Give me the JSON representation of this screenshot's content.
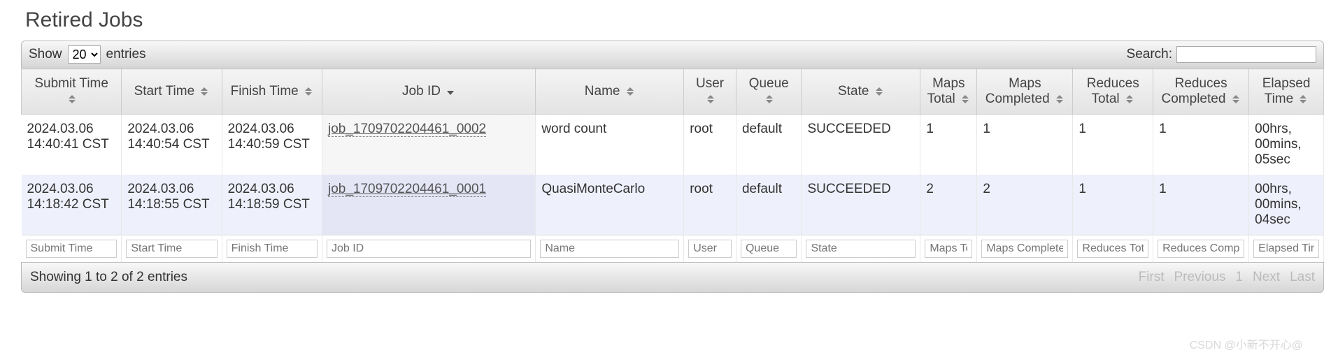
{
  "title": "Retired Jobs",
  "toolbar": {
    "show_label": "Show",
    "entries_label": "entries",
    "search_label": "Search:",
    "page_size_value": "20"
  },
  "columns": {
    "submit_time": "Submit Time",
    "start_time": "Start Time",
    "finish_time": "Finish Time",
    "job_id": "Job ID",
    "name": "Name",
    "user": "User",
    "queue": "Queue",
    "state": "State",
    "maps_total": "Maps Total",
    "maps_completed": "Maps Completed",
    "reduces_total": "Reduces Total",
    "reduces_completed": "Reduces Completed",
    "elapsed_time": "Elapsed Time"
  },
  "filters": {
    "submit_time": "Submit Time",
    "start_time": "Start Time",
    "finish_time": "Finish Time",
    "job_id": "Job ID",
    "name": "Name",
    "user": "User",
    "queue": "Queue",
    "state": "State",
    "maps_total": "Maps Total",
    "maps_completed": "Maps Completed",
    "reduces_total": "Reduces Total",
    "reduces_completed": "Reduces Completed",
    "elapsed_time": "Elapsed Time"
  },
  "rows": [
    {
      "submit_time": "2024.03.06 14:40:41 CST",
      "start_time": "2024.03.06 14:40:54 CST",
      "finish_time": "2024.03.06 14:40:59 CST",
      "job_id": "job_1709702204461_0002",
      "name": "word count",
      "user": "root",
      "queue": "default",
      "state": "SUCCEEDED",
      "maps_total": "1",
      "maps_completed": "1",
      "reduces_total": "1",
      "reduces_completed": "1",
      "elapsed_time": "00hrs, 00mins, 05sec"
    },
    {
      "submit_time": "2024.03.06 14:18:42 CST",
      "start_time": "2024.03.06 14:18:55 CST",
      "finish_time": "2024.03.06 14:18:59 CST",
      "job_id": "job_1709702204461_0001",
      "name": "QuasiMonteCarlo",
      "user": "root",
      "queue": "default",
      "state": "SUCCEEDED",
      "maps_total": "2",
      "maps_completed": "2",
      "reduces_total": "1",
      "reduces_completed": "1",
      "elapsed_time": "00hrs, 00mins, 04sec"
    }
  ],
  "footer": {
    "info": "Showing 1 to 2 of 2 entries",
    "first": "First",
    "previous": "Previous",
    "page": "1",
    "next": "Next",
    "last": "Last"
  },
  "watermark": "CSDN @小新不开心@"
}
